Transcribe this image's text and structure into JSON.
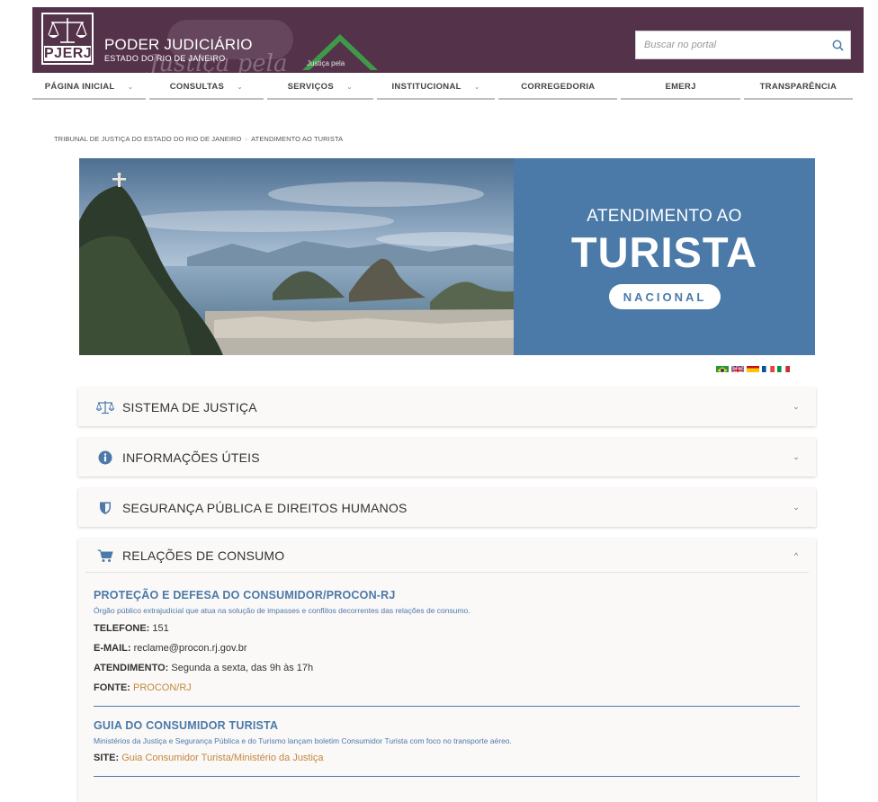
{
  "header": {
    "brand_title": "PODER JUDICIÁRIO",
    "brand_sub": "ESTADO DO RIO DE JANEIRO",
    "logo_text": "PJERJ",
    "deco_text": "Justiça pela",
    "deco_green_text": "Justiça pela",
    "search_placeholder": "Buscar no portal"
  },
  "nav": [
    {
      "label": "PÁGINA INICIAL",
      "chevron": "⌄",
      "width": 128
    },
    {
      "label": "CONSULTAS",
      "chevron": "⌄",
      "width": 128
    },
    {
      "label": "SERVIÇOS",
      "chevron": "⌄",
      "width": 120
    },
    {
      "label": "INSTITUCIONAL",
      "chevron": "⌄",
      "width": 133
    },
    {
      "label": "CORREGEDORIA",
      "chevron": "",
      "width": 134
    },
    {
      "label": "EMERJ",
      "chevron": "",
      "width": 134
    },
    {
      "label": "TRANSPARÊNCIA",
      "chevron": "",
      "width": 123
    }
  ],
  "breadcrumb": {
    "items": [
      "TRIBUNAL DE JUSTIÇA DO ESTADO DO RIO DE JANEIRO",
      "ATENDIMENTO AO TURISTA"
    ],
    "separator": "›"
  },
  "banner": {
    "line1": "ATENDIMENTO AO",
    "line2": "TURISTA",
    "pill": "NACIONAL"
  },
  "flags": [
    "brazil-flag-icon",
    "uk-flag-icon",
    "spain-flag-icon",
    "france-flag-icon",
    "italy-flag-icon"
  ],
  "accordions": [
    {
      "title": "SISTEMA DE JUSTIÇA",
      "icon": "scales-icon",
      "chevron": "⌄"
    },
    {
      "title": "INFORMAÇÕES ÚTEIS",
      "icon": "info-icon",
      "chevron": "⌄"
    },
    {
      "title": "SEGURANÇA PÚBLICA E DIREITOS HUMANOS",
      "icon": "shield-icon",
      "chevron": "⌄"
    },
    {
      "title": "RELAÇÕES DE CONSUMO",
      "icon": "cart-icon",
      "chevron": "^"
    }
  ],
  "consumo": {
    "procon": {
      "title": "PROTEÇÃO E DEFESA DO CONSUMIDOR/PROCON-RJ",
      "desc": "Órgão público extrajudicial que atua na solução de impasses e conflitos decorrentes das relações de consumo.",
      "telefone_label": "TELEFONE:",
      "telefone_value": "151",
      "email_label": "E-MAIL:",
      "email_value": "reclame@procon.rj.gov.br",
      "atendimento_label": "ATENDIMENTO:",
      "atendimento_value": "Segunda a sexta, das 9h às 17h",
      "fonte_label": "FONTE:",
      "fonte_value": "PROCON/RJ"
    },
    "guia": {
      "title": "GUIA DO CONSUMIDOR TURISTA",
      "desc": "Ministérios da Justiça e Segurança Pública e do Turismo lançam boletim Consumidor Turista com foco no transporte aéreo.",
      "site_label": "SITE:",
      "site_value": "Guia Consumidor Turista/Ministério da Justiça"
    }
  },
  "colors": {
    "header_bg": "#54324a",
    "accent_blue": "#4b7aa8",
    "link_gold": "#c0893d"
  }
}
